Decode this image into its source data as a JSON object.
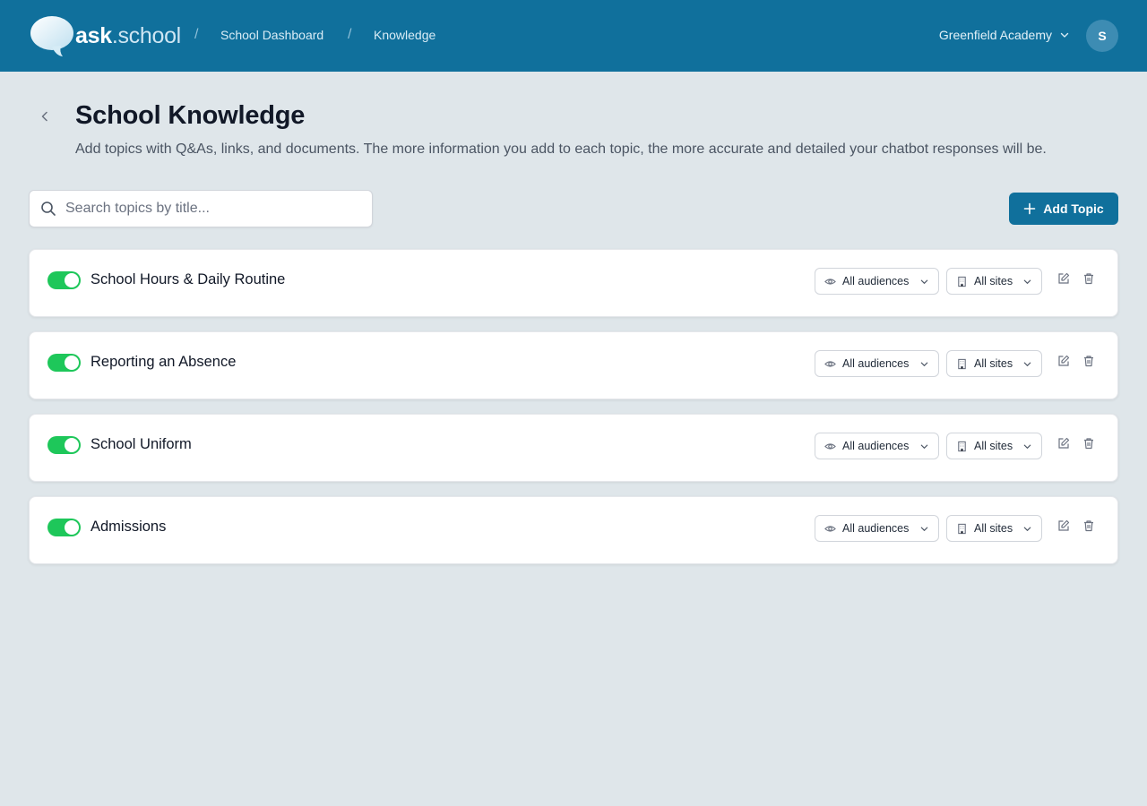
{
  "header": {
    "logo_ask": "ask",
    "logo_school": ".school",
    "breadcrumb_sep": "/",
    "breadcrumbs": [
      "School Dashboard",
      "Knowledge"
    ],
    "org_name": "Greenfield Academy",
    "avatar_initial": "S",
    "colors": {
      "bar": "#10709c",
      "accent": "#10709c"
    }
  },
  "page": {
    "title": "School Knowledge",
    "description": "Add topics with Q&As, links, and documents. The more information you add to each topic, the more accurate and detailed your chatbot responses will be."
  },
  "search": {
    "placeholder": "Search topics by title...",
    "value": ""
  },
  "add_button": {
    "label": "Add Topic"
  },
  "topics": [
    {
      "title": "School Hours & Daily Routine",
      "enabled": true,
      "audience": "All audiences",
      "sites": "All sites"
    },
    {
      "title": "Reporting an Absence",
      "enabled": true,
      "audience": "All audiences",
      "sites": "All sites"
    },
    {
      "title": "School Uniform",
      "enabled": true,
      "audience": "All audiences",
      "sites": "All sites"
    },
    {
      "title": "Admissions",
      "enabled": true,
      "audience": "All audiences",
      "sites": "All sites"
    }
  ],
  "icons": {
    "back": "chevron-left-icon",
    "search": "search-icon",
    "add": "plus-icon",
    "audience": "eye-icon",
    "sites": "building-icon",
    "edit": "edit-icon",
    "delete": "trash-icon",
    "dropdown": "chevron-down-icon"
  },
  "toggle_on_color": "#1ec75a"
}
